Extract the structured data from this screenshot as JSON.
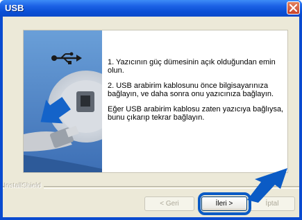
{
  "window": {
    "title": "USB",
    "close_icon": "close-icon"
  },
  "content": {
    "step1": "1. Yazıcının güç dümesinin açık olduğundan emin olun.",
    "step2": "2. USB arabirim kablosunu önce bilgisayarınıza bağlayın, ve daha sonra onu yazıcınıza bağlayın.",
    "step3": "Eğer USB arabirim kablosu zaten yazıcıya bağlıysa, bunu çıkarıp tekrar bağlayın."
  },
  "footer": {
    "brand": "InstallShield"
  },
  "buttons": {
    "back_label": "< Geri",
    "next_label": "İleri >",
    "cancel_label": "İptal"
  },
  "colors": {
    "titlebar": "#0a4fd6",
    "highlight": "#0b5bc5",
    "dialog_bg": "#ece9d8"
  }
}
